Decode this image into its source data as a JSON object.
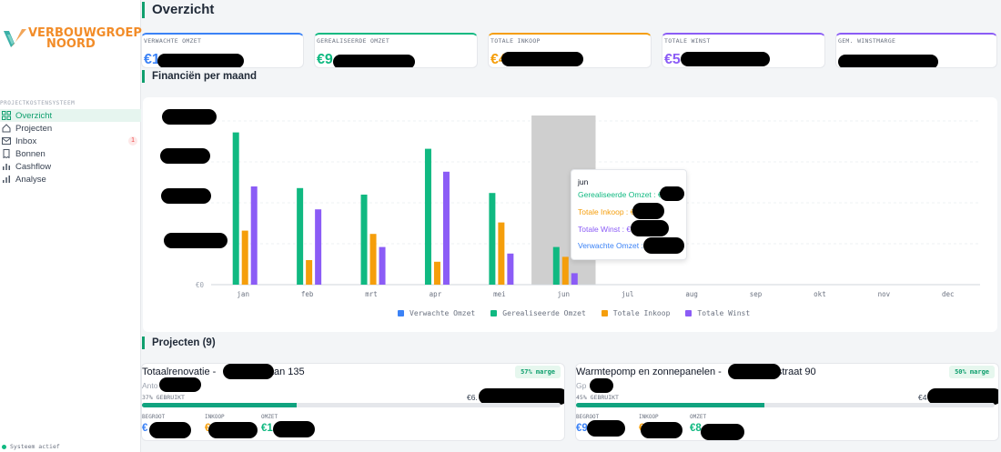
{
  "brand": {
    "line1": "VERBOUWGROEP",
    "line2": "NOORD"
  },
  "sidebar": {
    "section_label": "PROJECTKOSTENSYSTEEM",
    "items": [
      {
        "label": "Overzicht",
        "icon": "grid-icon",
        "active": true
      },
      {
        "label": "Projecten",
        "icon": "home-icon"
      },
      {
        "label": "Inbox",
        "icon": "inbox-icon",
        "badge": "1"
      },
      {
        "label": "Bonnen",
        "icon": "receipt-icon"
      },
      {
        "label": "Cashflow",
        "icon": "bar-chart-icon"
      },
      {
        "label": "Analyse",
        "icon": "analytics-icon"
      }
    ],
    "status": "Systeem actief"
  },
  "page": {
    "title": "Overzicht"
  },
  "kpis": [
    {
      "label": "VERWACHTE OMZET",
      "value": "€1",
      "color": "#3b82f6"
    },
    {
      "label": "GEREALISEERDE OMZET",
      "value": "€9",
      "color": "#10b981"
    },
    {
      "label": "TOTALE INKOOP",
      "value": "€4",
      "color": "#f59e0b"
    },
    {
      "label": "TOTALE WINST",
      "value": "€5",
      "color": "#8b5cf6"
    },
    {
      "label": "GEM. WINSTMARGE",
      "value": "",
      "color": "#8b5cf6"
    }
  ],
  "chart_section": {
    "title": "Financiën per maand"
  },
  "chart_data": {
    "type": "bar",
    "categories": [
      "jan",
      "feb",
      "mrt",
      "apr",
      "mei",
      "jun",
      "jul",
      "aug",
      "sep",
      "okt",
      "nov",
      "dec"
    ],
    "series": [
      {
        "name": "Verwachte Omzet",
        "color": "#3b82f6",
        "values": [
          0,
          0,
          0,
          0,
          0,
          0,
          0,
          0,
          0,
          0,
          0,
          0
        ]
      },
      {
        "name": "Gerealiseerde Omzet",
        "color": "#10b981",
        "values": [
          0.93,
          0.59,
          0.55,
          0.83,
          0.56,
          0.23,
          0,
          0,
          0,
          0,
          0,
          0
        ]
      },
      {
        "name": "Totale Inkoop",
        "color": "#f59e0b",
        "values": [
          0.33,
          0.15,
          0.31,
          0.14,
          0.38,
          0.17,
          0,
          0,
          0,
          0,
          0,
          0
        ]
      },
      {
        "name": "Totale Winst",
        "color": "#8b5cf6",
        "values": [
          0.6,
          0.46,
          0.23,
          0.69,
          0.19,
          0.07,
          0,
          0,
          0,
          0,
          0,
          0
        ]
      }
    ],
    "y_tick_labels": [
      "€0"
    ],
    "highlighted_category": "jun",
    "legend_position": "bottom",
    "grid": true
  },
  "tooltip": {
    "title": "jun",
    "rows": [
      {
        "label": "Gerealiseerde Omzet : €",
        "color": "#10b981"
      },
      {
        "label": "Totale Inkoop : €",
        "color": "#f59e0b"
      },
      {
        "label": "Totale Winst : €",
        "color": "#8b5cf6"
      },
      {
        "label": "Verwachte Omzet : €",
        "color": "#3b82f6"
      }
    ]
  },
  "projects_section": {
    "title": "Projecten (9)"
  },
  "projects": [
    {
      "title_start": "Totaalrenovatie - ",
      "title_end": "laan 135",
      "margin": "57% marge",
      "client": "Anto",
      "used": "37% GEBRUIKT",
      "used_fraction": 0.37,
      "amount": "€6.",
      "metrics": [
        {
          "label": "BEGROOT",
          "value": "€",
          "color": "#3b82f6"
        },
        {
          "label": "INKOOP",
          "value": "€",
          "color": "#f59e0b"
        },
        {
          "label": "OMZET",
          "value": "€1",
          "color": "#10b981"
        }
      ]
    },
    {
      "title_start": "Warmtepomp en zonnepanelen - ",
      "title_end": "straat 90",
      "margin": "50% marge",
      "client": "Gp",
      "used": "45% GEBRUIKT",
      "used_fraction": 0.45,
      "amount": "€4",
      "metrics": [
        {
          "label": "BEGROOT",
          "value": "€9",
          "color": "#3b82f6"
        },
        {
          "label": "INKOOP",
          "value": "€",
          "color": "#f59e0b"
        },
        {
          "label": "OMZET",
          "value": "€8",
          "color": "#10b981"
        }
      ]
    }
  ]
}
